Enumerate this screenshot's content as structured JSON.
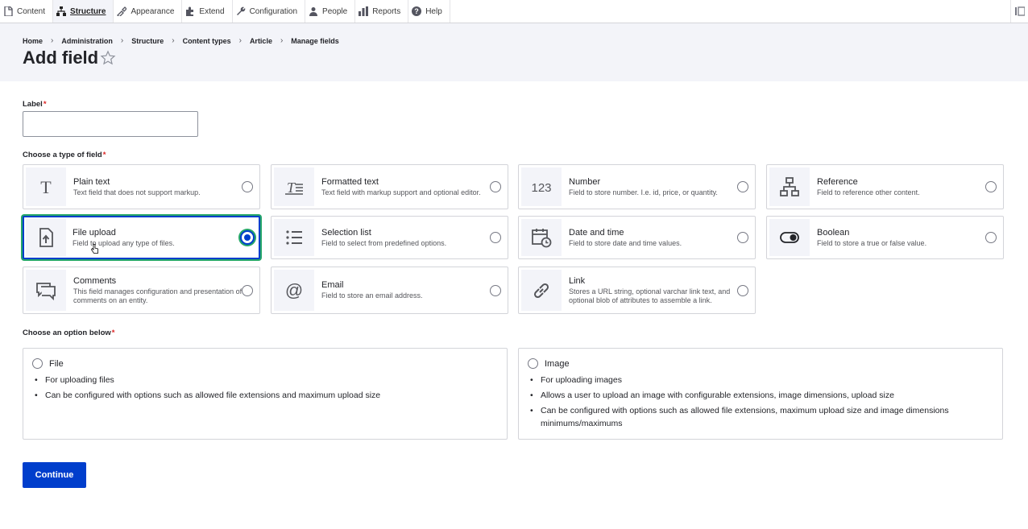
{
  "toolbar": {
    "items": [
      {
        "label": "Content",
        "icon": "content-icon"
      },
      {
        "label": "Structure",
        "icon": "structure-icon",
        "active": true
      },
      {
        "label": "Appearance",
        "icon": "appearance-icon"
      },
      {
        "label": "Extend",
        "icon": "extend-icon"
      },
      {
        "label": "Configuration",
        "icon": "configuration-icon"
      },
      {
        "label": "People",
        "icon": "people-icon"
      },
      {
        "label": "Reports",
        "icon": "reports-icon"
      },
      {
        "label": "Help",
        "icon": "help-icon"
      }
    ]
  },
  "breadcrumb": [
    "Home",
    "Administration",
    "Structure",
    "Content types",
    "Article",
    "Manage fields"
  ],
  "page_title": "Add field",
  "label_field": {
    "label": "Label",
    "required": "*",
    "value": ""
  },
  "field_type_section": {
    "label": "Choose a type of field",
    "required": "*"
  },
  "field_types": [
    {
      "title": "Plain text",
      "desc": "Text field that does not support markup.",
      "icon": "plain-text-icon"
    },
    {
      "title": "Formatted text",
      "desc": "Text field with markup support and optional editor.",
      "icon": "formatted-text-icon"
    },
    {
      "title": "Number",
      "desc": "Field to store number. I.e. id, price, or quantity.",
      "icon": "number-icon"
    },
    {
      "title": "Reference",
      "desc": "Field to reference other content.",
      "icon": "reference-icon"
    },
    {
      "title": "File upload",
      "desc": "Field to upload any type of files.",
      "icon": "file-upload-icon",
      "selected": true
    },
    {
      "title": "Selection list",
      "desc": "Field to select from predefined options.",
      "icon": "selection-list-icon"
    },
    {
      "title": "Date and time",
      "desc": "Field to store date and time values.",
      "icon": "date-time-icon"
    },
    {
      "title": "Boolean",
      "desc": "Field to store a true or false value.",
      "icon": "boolean-icon"
    },
    {
      "title": "Comments",
      "desc": "This field manages configuration and presentation of comments on an entity.",
      "icon": "comments-icon"
    },
    {
      "title": "Email",
      "desc": "Field to store an email address.",
      "icon": "email-icon"
    },
    {
      "title": "Link",
      "desc": "Stores a URL string, optional varchar link text, and optional blob of attributes to assemble a link.",
      "icon": "link-icon"
    }
  ],
  "option_section": {
    "label": "Choose an option below",
    "required": "*"
  },
  "options": [
    {
      "title": "File",
      "bullets": [
        "For uploading files",
        "Can be configured with options such as allowed file extensions and maximum upload size"
      ]
    },
    {
      "title": "Image",
      "bullets": [
        "For uploading images",
        "Allows a user to upload an image with configurable extensions, image dimensions, upload size",
        "Can be configured with options such as allowed file extensions, maximum upload size and image dimensions minimums/maximums"
      ]
    }
  ],
  "continue_label": "Continue",
  "colors": {
    "primary": "#003ecc",
    "focus": "#26a769",
    "required": "#dc2323",
    "header_bg": "#f3f4f9"
  }
}
